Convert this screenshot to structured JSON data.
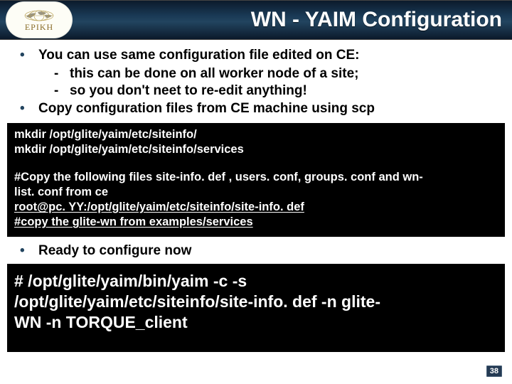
{
  "logo": {
    "brand": "EPIKH"
  },
  "header": {
    "title": "WN - YAIM Configuration"
  },
  "bullets": {
    "line1": "You can use same configuration file edited on CE:",
    "sub1": "this can be done on all worker node of a site;",
    "sub2": "so you don't neet to re-edit anything!",
    "line2": "Copy configuration files from CE machine using scp",
    "line3": "Ready to configure now"
  },
  "code1": {
    "l1": "mkdir /opt/glite/yaim/etc/siteinfo/",
    "l2": "mkdir /opt/glite/yaim/etc/siteinfo/services",
    "l3a": "#Copy the following files site-info. def , users. conf, groups. conf and wn-",
    "l3b": "list. conf from ce",
    "l4_user": "root@pc. YY:",
    "l4_path": "/opt/glite/yaim/etc/siteinfo/site-info. def",
    "l5": "#copy the glite-wn from examples/services"
  },
  "code2": {
    "l1": "# /opt/glite/yaim/bin/yaim -c -s",
    "l2": "/opt/glite/yaim/etc/siteinfo/site-info. def -n glite-",
    "l3": "WN  -n TORQUE_client"
  },
  "page": {
    "num": "38"
  }
}
